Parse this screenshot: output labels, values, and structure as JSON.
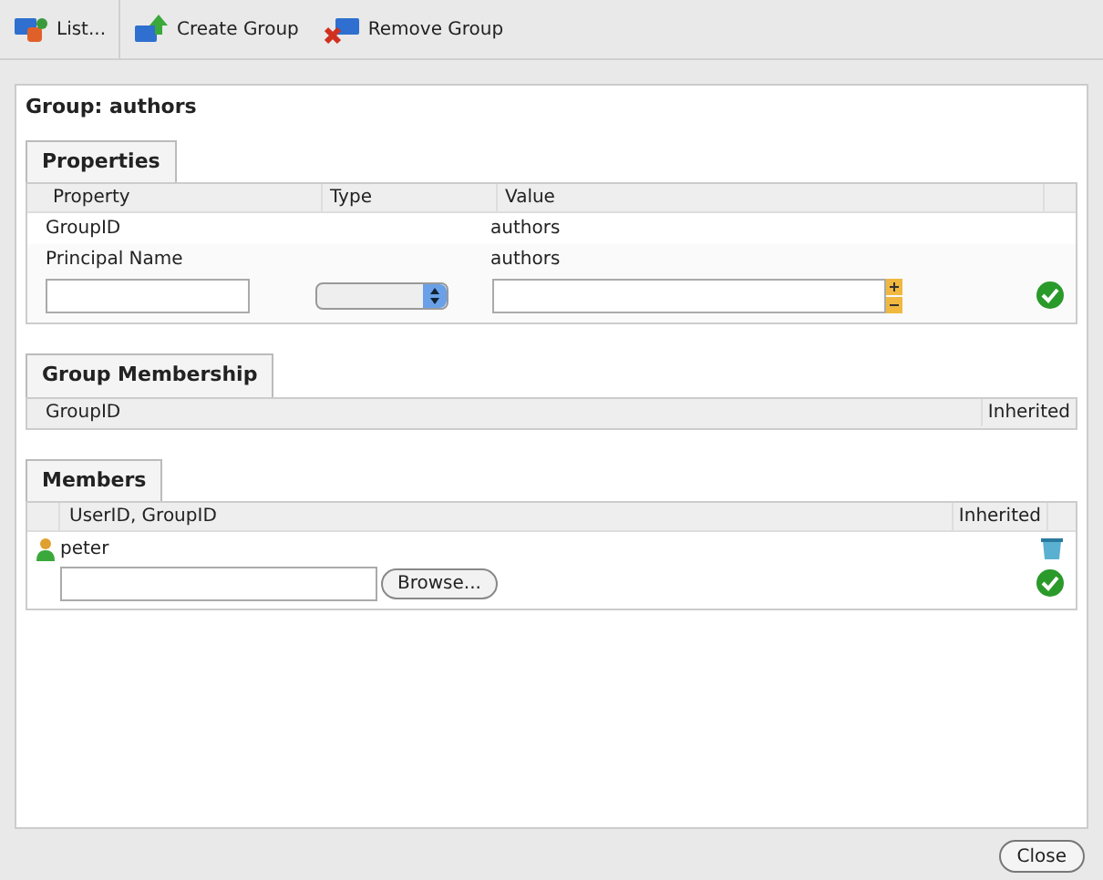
{
  "toolbar": [
    {
      "label": "List...",
      "kind": "list"
    },
    {
      "label": "Create Group",
      "kind": "create"
    },
    {
      "label": "Remove Group",
      "kind": "remove"
    }
  ],
  "title": "Group: authors",
  "properties": {
    "tab": "Properties",
    "columns": [
      "Property",
      "Type",
      "Value"
    ],
    "rows": [
      {
        "property": "GroupID",
        "value": "authors"
      },
      {
        "property": "Principal Name",
        "value": "authors"
      }
    ]
  },
  "membership": {
    "tab": "Group Membership",
    "columns": [
      "GroupID",
      "Inherited"
    ]
  },
  "members": {
    "tab": "Members",
    "columns": [
      "UserID, GroupID",
      "Inherited"
    ],
    "rows": [
      {
        "name": "peter"
      }
    ],
    "browse": "Browse..."
  },
  "close": "Close"
}
